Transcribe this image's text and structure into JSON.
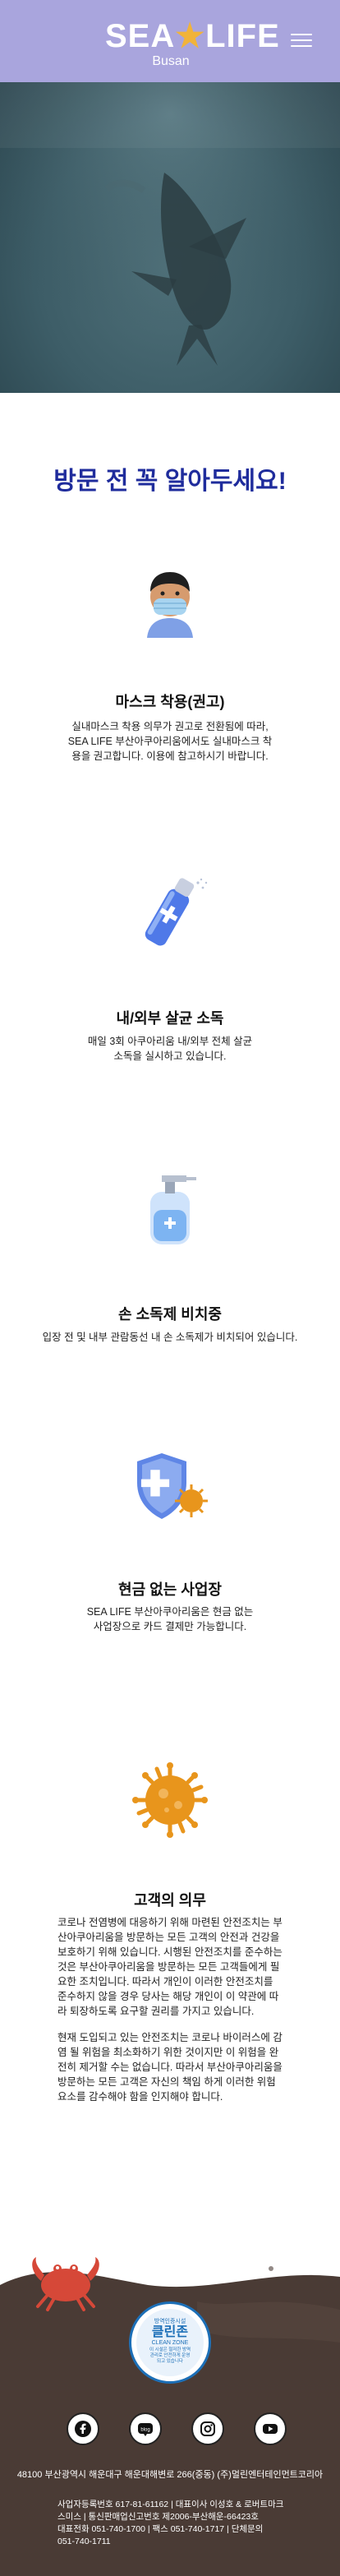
{
  "header": {
    "logo_text_left": "SEA",
    "logo_star": "★",
    "logo_text_right": "LIFE",
    "logo_sub": "Busan",
    "menu_icon": "hamburger-menu-icon"
  },
  "hero": {
    "image": "shark-underwater"
  },
  "section_title": "방문 전 꼭 알아두세요!",
  "items": [
    {
      "icon": "masked-person-icon",
      "title": "마스크 착용(권고)",
      "desc": [
        "실내마스크 착용 의무가 권고로 전환됨에 따라,",
        "SEA LIFE 부산아쿠아리움에서도 실내마스크 착",
        "용을 권고합니다. 이용에 참고하시기 바랍니다."
      ]
    },
    {
      "icon": "disinfectant-spray-icon",
      "title": "내/외부 살균 소독",
      "desc": [
        "매일 3회 아쿠아리움 내/외부 전체 살균",
        "소독을 실시하고 있습니다."
      ]
    },
    {
      "icon": "hand-sanitizer-icon",
      "title": "손 소독제 비치중",
      "desc": [
        "입장 전 및 내부 관람동선 내 손 소독제가 비치되어 있습니다."
      ]
    },
    {
      "icon": "shield-virus-icon",
      "title": "현금 없는 사업장",
      "desc": [
        "SEA LIFE 부산아쿠아리움은 현금 없는",
        "사업장으로 카드 결제만 가능합니다."
      ]
    },
    {
      "icon": "virus-icon",
      "title": "고객의 의무"
    }
  ],
  "notice": {
    "p1": [
      "코로나 전염병에 대응하기 위해 마련된 안전조치는 부",
      "산아쿠아리움을 방문하는 모든 고객의 안전과 건강을",
      "보호하기 위해 있습니다. 시행된 안전조치를 준수하는",
      "것은 부산아쿠아리움을 방문하는 모든 고객들에게 필",
      "요한 조치입니다. 따라서 개인이 이러한 안전조치를",
      "준수하지 않을 경우 당사는 해당 개인이 이 약관에 따",
      "라 퇴장하도록 요구할 권리를 가지고 있습니다."
    ],
    "p2": [
      "현재 도입되고 있는 안전조치는 코로나 바이러스에 감",
      "염 될 위험을 최소화하기 위한 것이지만 이 위험을 완",
      "전히 제거할 수는 없습니다. 따라서 부산아쿠아리움을",
      "방문하는 모든 고객은 자신의 책임 하게 이러한 위험",
      "요소를 감수해야 함을 인지해야 합니다."
    ]
  },
  "badge": {
    "top": "방역인증시설",
    "main": "클린존",
    "en": "CLEAN ZONE",
    "desc": [
      "이 시설은 철저한 방역",
      "관리로 안전하게 운영",
      "되고 있습니다",
      "부산광역시"
    ]
  },
  "social": [
    {
      "icon": "facebook-icon",
      "label": "facebook"
    },
    {
      "icon": "blog-icon",
      "label": "blog"
    },
    {
      "icon": "instagram-icon",
      "label": "instagram"
    },
    {
      "icon": "youtube-icon",
      "label": "youtube"
    }
  ],
  "footer": {
    "address": "48100 부산광역시 해운대구 해운대해변로 266(중동) (주)멀린엔터테인먼트코리아",
    "biz": [
      "사업자등록번호 617-81-61162 | 대표이사 이성호 & 로버트마크",
      "스미스 | 통신판매업신고번호 제2006-부산해운-66423호",
      "대표전화 051-740-1700 | 팩스 051-740-1717 | 단체문의",
      "051-740-1711"
    ]
  },
  "colors": {
    "header_bg": "#a9a5dd",
    "title": "#1f2c9c",
    "footer_ground": "#4a3b35",
    "star": "#f1b33a"
  }
}
